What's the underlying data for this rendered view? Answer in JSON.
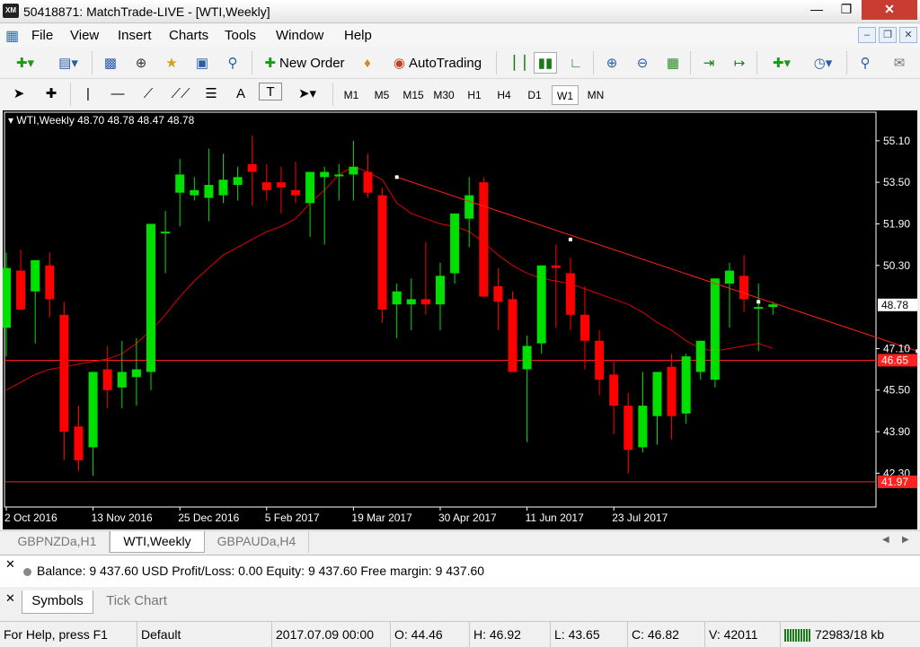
{
  "window": {
    "title": "50418871: MatchTrade-LIVE - [WTI,Weekly]",
    "app_icon_text": "XM"
  },
  "menu": [
    "File",
    "View",
    "Insert",
    "Charts",
    "Tools",
    "Window",
    "Help"
  ],
  "toolbar": {
    "new_order": "New Order",
    "autotrading": "AutoTrading",
    "text_tool": "A",
    "label_tool": "T"
  },
  "timeframes": [
    "M1",
    "M5",
    "M15",
    "M30",
    "H1",
    "H4",
    "D1",
    "W1",
    "MN"
  ],
  "active_timeframe": "W1",
  "chart": {
    "label": "WTI,Weekly  48.70 48.78 48.47 48.78"
  },
  "chart_data": {
    "type": "candlestick",
    "symbol": "WTI",
    "timeframe": "Weekly",
    "ylim": [
      41.0,
      56.2
    ],
    "price_ticks": [
      "55.10",
      "53.50",
      "51.90",
      "50.30",
      "47.10",
      "45.50",
      "43.90",
      "42.30"
    ],
    "date_ticks": [
      "2 Oct 2016",
      "13 Nov 2016",
      "25 Dec 2016",
      "5 Feb 2017",
      "19 Mar 2017",
      "30 Apr 2017",
      "11 Jun 2017",
      "23 Jul 2017"
    ],
    "current_price": "48.78",
    "hline1_label": "46.65",
    "hline1_value": 46.65,
    "hline2_label": "41.97",
    "hline2_value": 41.97,
    "up_color": "#00e000",
    "down_color": "#ff0000",
    "ma_color": "#e00000",
    "trendline": [
      [
        27,
        53.7
      ],
      [
        63,
        47.0
      ]
    ],
    "trendline_mid_points": [
      [
        39,
        51.3
      ],
      [
        52,
        48.9
      ]
    ],
    "candles": [
      {
        "o": 47.9,
        "h": 50.8,
        "l": 46.8,
        "c": 50.2
      },
      {
        "o": 50.1,
        "h": 50.9,
        "l": 48.8,
        "c": 48.6
      },
      {
        "o": 49.3,
        "h": 50.4,
        "l": 47.3,
        "c": 50.5
      },
      {
        "o": 50.3,
        "h": 50.8,
        "l": 48.3,
        "c": 49.0
      },
      {
        "o": 48.4,
        "h": 48.9,
        "l": 42.8,
        "c": 43.9
      },
      {
        "o": 44.1,
        "h": 44.9,
        "l": 42.4,
        "c": 42.8
      },
      {
        "o": 43.3,
        "h": 46.2,
        "l": 42.2,
        "c": 46.2
      },
      {
        "o": 46.3,
        "h": 47.2,
        "l": 44.8,
        "c": 45.5
      },
      {
        "o": 45.6,
        "h": 47.4,
        "l": 44.8,
        "c": 46.2
      },
      {
        "o": 46.0,
        "h": 47.5,
        "l": 44.9,
        "c": 46.3
      },
      {
        "o": 46.2,
        "h": 51.9,
        "l": 45.5,
        "c": 51.9
      },
      {
        "o": 51.6,
        "h": 52.4,
        "l": 50.0,
        "c": 51.6
      },
      {
        "o": 53.1,
        "h": 54.4,
        "l": 51.8,
        "c": 53.8
      },
      {
        "o": 53.0,
        "h": 53.7,
        "l": 52.8,
        "c": 53.2
      },
      {
        "o": 52.9,
        "h": 54.8,
        "l": 52.0,
        "c": 53.4
      },
      {
        "o": 53.0,
        "h": 54.6,
        "l": 52.7,
        "c": 53.6
      },
      {
        "o": 53.4,
        "h": 54.1,
        "l": 52.8,
        "c": 53.7
      },
      {
        "o": 54.2,
        "h": 55.3,
        "l": 52.6,
        "c": 53.9
      },
      {
        "o": 53.5,
        "h": 54.2,
        "l": 52.8,
        "c": 53.2
      },
      {
        "o": 53.5,
        "h": 54.1,
        "l": 52.3,
        "c": 53.3
      },
      {
        "o": 53.2,
        "h": 54.3,
        "l": 52.7,
        "c": 53.0
      },
      {
        "o": 52.7,
        "h": 53.9,
        "l": 51.4,
        "c": 53.9
      },
      {
        "o": 53.7,
        "h": 54.1,
        "l": 51.1,
        "c": 53.9
      },
      {
        "o": 53.8,
        "h": 54.2,
        "l": 52.8,
        "c": 53.8
      },
      {
        "o": 53.8,
        "h": 55.1,
        "l": 52.8,
        "c": 54.1
      },
      {
        "o": 53.9,
        "h": 54.6,
        "l": 52.9,
        "c": 53.1
      },
      {
        "o": 53.0,
        "h": 53.3,
        "l": 48.1,
        "c": 48.6
      },
      {
        "o": 48.8,
        "h": 49.6,
        "l": 47.5,
        "c": 49.3
      },
      {
        "o": 48.8,
        "h": 49.8,
        "l": 47.8,
        "c": 49.0
      },
      {
        "o": 49.0,
        "h": 51.2,
        "l": 48.4,
        "c": 48.8
      },
      {
        "o": 48.8,
        "h": 50.4,
        "l": 47.8,
        "c": 49.9
      },
      {
        "o": 50.0,
        "h": 52.3,
        "l": 49.6,
        "c": 52.3
      },
      {
        "o": 52.1,
        "h": 53.7,
        "l": 51.0,
        "c": 53.0
      },
      {
        "o": 53.5,
        "h": 53.7,
        "l": 49.3,
        "c": 49.1
      },
      {
        "o": 49.5,
        "h": 50.2,
        "l": 47.8,
        "c": 48.9
      },
      {
        "o": 49.0,
        "h": 49.3,
        "l": 46.4,
        "c": 46.2
      },
      {
        "o": 46.3,
        "h": 47.6,
        "l": 43.5,
        "c": 47.2
      },
      {
        "o": 47.3,
        "h": 50.3,
        "l": 46.9,
        "c": 50.3
      },
      {
        "o": 50.3,
        "h": 51.1,
        "l": 47.9,
        "c": 50.2
      },
      {
        "o": 50.0,
        "h": 50.6,
        "l": 47.8,
        "c": 48.4
      },
      {
        "o": 48.4,
        "h": 49.5,
        "l": 46.3,
        "c": 47.4
      },
      {
        "o": 47.4,
        "h": 47.8,
        "l": 45.3,
        "c": 45.9
      },
      {
        "o": 46.1,
        "h": 46.6,
        "l": 43.8,
        "c": 44.9
      },
      {
        "o": 44.9,
        "h": 45.4,
        "l": 42.3,
        "c": 43.2
      },
      {
        "o": 43.3,
        "h": 46.2,
        "l": 43.1,
        "c": 44.9
      },
      {
        "o": 44.5,
        "h": 46.2,
        "l": 43.4,
        "c": 46.2
      },
      {
        "o": 46.4,
        "h": 46.9,
        "l": 43.6,
        "c": 44.5
      },
      {
        "o": 44.6,
        "h": 46.9,
        "l": 44.2,
        "c": 46.8
      },
      {
        "o": 46.2,
        "h": 47.4,
        "l": 45.9,
        "c": 47.4
      },
      {
        "o": 45.9,
        "h": 47.2,
        "l": 45.6,
        "c": 49.8
      },
      {
        "o": 49.6,
        "h": 50.4,
        "l": 47.9,
        "c": 50.1
      },
      {
        "o": 49.9,
        "h": 50.7,
        "l": 48.5,
        "c": 49.0
      },
      {
        "o": 48.7,
        "h": 49.6,
        "l": 47.0,
        "c": 48.7
      },
      {
        "o": 48.7,
        "h": 48.9,
        "l": 48.4,
        "c": 48.8
      }
    ],
    "ma": [
      45.5,
      45.8,
      46.1,
      46.3,
      46.4,
      46.5,
      46.6,
      46.7,
      46.9,
      47.3,
      47.8,
      48.4,
      49.1,
      49.7,
      50.2,
      50.7,
      51.0,
      51.3,
      51.6,
      51.8,
      52.1,
      52.7,
      53.2,
      53.8,
      54.1,
      53.9,
      53.6,
      52.7,
      52.3,
      52.1,
      51.9,
      51.8,
      51.6,
      51.2,
      50.7,
      50.3,
      50.0,
      49.8,
      49.7,
      49.6,
      49.4,
      49.2,
      49.0,
      48.8,
      48.5,
      48.1,
      47.8,
      47.4,
      47.1,
      47.0,
      47.1,
      47.2,
      47.3,
      47.1
    ]
  },
  "chart_tabs": [
    "GBPNZDa,H1",
    "WTI,Weekly",
    "GBPAUDa,H4"
  ],
  "active_chart_tab": "WTI,Weekly",
  "terminal": {
    "balance_line": "Balance: 9 437.60 USD  Profit/Loss: 0.00  Equity: 9 437.60  Free margin: 9 437.60"
  },
  "navigator_tabs": [
    "Symbols",
    "Tick Chart"
  ],
  "status": {
    "help": "For Help, press F1",
    "profile": "Default",
    "datetime": "2017.07.09 00:00",
    "open": "O: 44.46",
    "high": "H: 46.92",
    "low": "L: 43.65",
    "close": "C: 46.82",
    "volume": "V: 42011",
    "traffic": "72983/18 kb"
  }
}
